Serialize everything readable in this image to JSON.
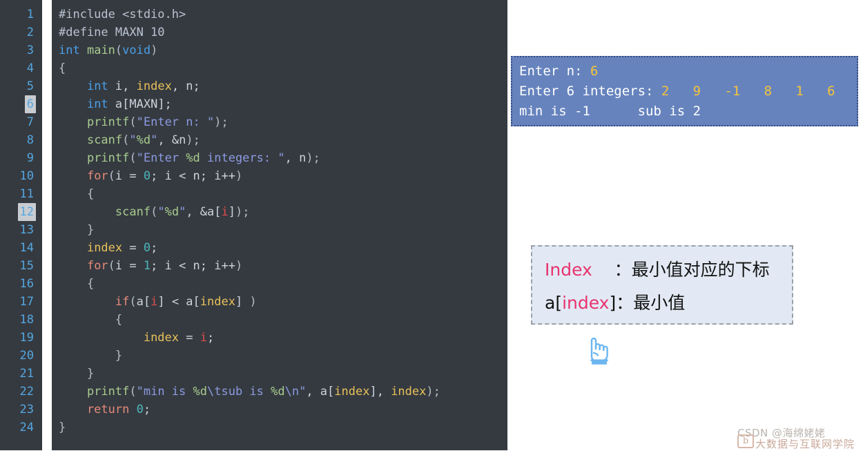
{
  "editor": {
    "line_numbers": [
      "1",
      "2",
      "3",
      "4",
      "5",
      "6",
      "7",
      "8",
      "9",
      "10",
      "11",
      "12",
      "13",
      "14",
      "15",
      "16",
      "17",
      "18",
      "19",
      "20",
      "21",
      "22",
      "23",
      "24"
    ],
    "marked_lines": [
      "6",
      "12"
    ],
    "code_lines": [
      "#include <stdio.h>",
      "#define MAXN 10",
      "int main(void)",
      "{",
      "    int i, index, n;",
      "    int a[MAXN];",
      "    printf(\"Enter n: \");",
      "    scanf(\"%d\", &n);",
      "    printf(\"Enter %d integers: \", n);",
      "    for(i = 0; i < n; i++)",
      "    {",
      "        scanf(\"%d\", &a[i]);",
      "    }",
      "    index = 0;",
      "    for(i = 1; i < n; i++)",
      "    {",
      "        if(a[i] < a[index] )",
      "        {",
      "            index = i;",
      "        }",
      "    }",
      "    printf(\"min is %d\\tsub is %d\\n\", a[index], index);",
      "    return 0;",
      "}"
    ],
    "colors": {
      "background": "#353a40",
      "gutter_background": "#353a40",
      "line_number": "#55a6e0",
      "marked_highlight": "#c8ccd0",
      "keyword": "#4a9fe8",
      "function": "#a9cc8f",
      "string": "#8c9ae0",
      "number": "#4db6bd",
      "variable": "#e8c05a",
      "control": "#e68a7a",
      "index_var": "#e04c4c",
      "plain": "#cdd3de"
    }
  },
  "terminal": {
    "lines": [
      {
        "prompt": "Enter n: ",
        "values": [
          "6"
        ]
      },
      {
        "prompt": "Enter 6 integers: ",
        "values": [
          "2",
          "9",
          "-1",
          "8",
          "1",
          "6"
        ]
      },
      {
        "prompt": "min is -1     sub is 2",
        "values": []
      }
    ],
    "line1_label": "Enter n: ",
    "line1_value": "6",
    "line2_label": "Enter 6 integers: ",
    "line2_values": "2   9   -1   8   1   6",
    "line3_text": "min is -1      sub is 2",
    "background_color": "#6683bd",
    "text_color": "#ffffff",
    "value_color": "#f5c33c"
  },
  "annotation": {
    "line1_term": "Index",
    "line1_sep": "    ：",
    "line1_desc": "最小值对应的下标",
    "line2_prefix": "a[",
    "line2_term": "index",
    "line2_suffix": "]",
    "line2_sep": "：",
    "line2_desc": "最小值",
    "background_color": "#e2e9f4",
    "border_color": "#9aa0a8",
    "highlight_color": "#e8336e"
  },
  "hand_icon": {
    "name": "pointing-up-hand-icon",
    "color": "#6cb6ef"
  },
  "watermark": {
    "top_text": "CSDN @海绵姥姥",
    "bottom_text": "大数据与互联网学院",
    "logo_text": "b"
  }
}
